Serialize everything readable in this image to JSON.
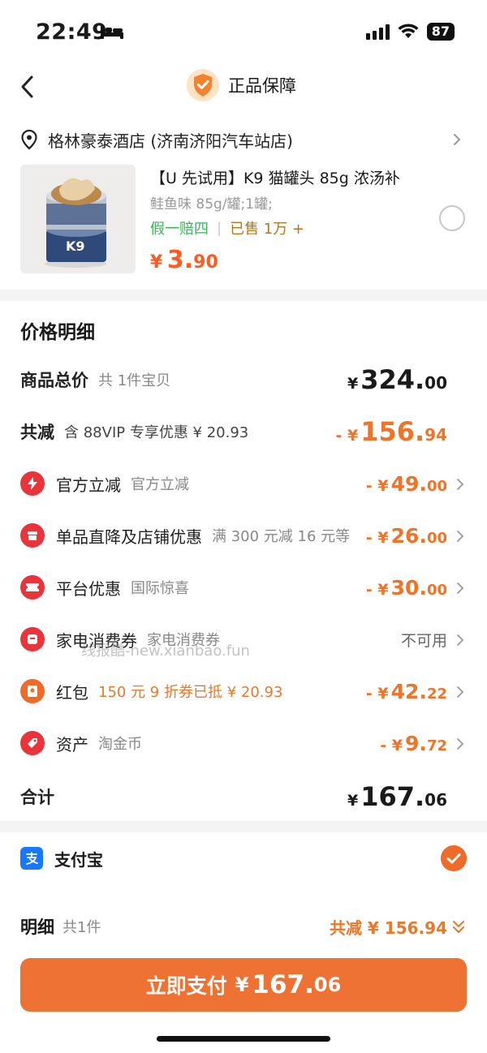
{
  "status_bar": {
    "time": "22:49",
    "battery": "87"
  },
  "header": {
    "title": "正品保障"
  },
  "store": {
    "name": "格林豪泰酒店 (济南济阳汽车站店)"
  },
  "product": {
    "title": "【U 先试用】K9 猫罐头 85g 浓汤补",
    "spec": "鲑鱼味 85g/罐;1罐;",
    "tag_guarantee": "假一赔四",
    "tag_sold": "已售 1万 +",
    "price_symbol": "¥",
    "price_int": "3.",
    "price_dec": "90"
  },
  "details": {
    "title": "价格明细",
    "total": {
      "label": "商品总价",
      "sub": "共 1件宝贝",
      "symbol": "¥",
      "int": "324.",
      "dec": "00"
    },
    "reduction": {
      "label": "共减",
      "sub": "含 88VIP 专享优惠 ¥ 20.93",
      "prefix": "- ¥",
      "int": "156.",
      "dec": "94"
    },
    "items": [
      {
        "label": "官方立减",
        "sub": "官方立减",
        "prefix": "- ¥",
        "int": "49.",
        "dec": "00",
        "icon": "lightning-icon"
      },
      {
        "label": "单品直降及店铺优惠",
        "sub": "满 300 元减 16 元等",
        "prefix": "- ¥",
        "int": "26.",
        "dec": "00",
        "icon": "store-icon"
      },
      {
        "label": "平台优惠",
        "sub": "国际惊喜",
        "prefix": "- ¥",
        "int": "30.",
        "dec": "00",
        "icon": "ticket-icon"
      },
      {
        "label": "家电消费券",
        "sub": "家电消费券",
        "status": "不可用",
        "icon": "coupon-icon"
      },
      {
        "label": "红包",
        "sub": "150 元 9 折券已抵 ¥ 20.93",
        "prefix": "- ¥",
        "int": "42.",
        "dec": "22",
        "icon": "red-packet-icon"
      },
      {
        "label": "资产",
        "sub": "淘金币",
        "prefix": "- ¥",
        "int": "9.",
        "dec": "72",
        "icon": "tag-icon"
      }
    ],
    "grand_total": {
      "label": "合计",
      "symbol": "¥",
      "int": "167.",
      "dec": "06"
    }
  },
  "watermark": "线报酷-new.xianbao.fun",
  "payment": {
    "method": "支付宝"
  },
  "summary": {
    "label": "明细",
    "count": "共1件",
    "discount": "共减 ¥ 156.94"
  },
  "pay_button": {
    "label": "立即支付",
    "symbol": "¥",
    "int": "167.",
    "dec": "06"
  },
  "colors": {
    "accent": "#ee7233",
    "discount": "#f07428",
    "alipay": "#1677ff",
    "guarantee_green": "#3ab55a"
  }
}
